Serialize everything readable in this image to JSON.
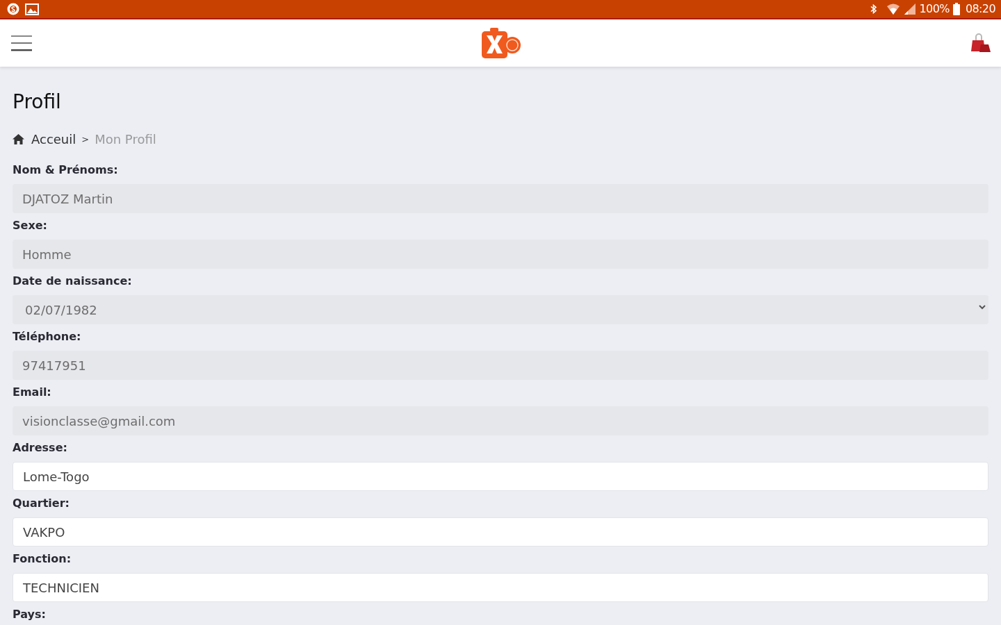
{
  "status_bar": {
    "battery": "100%",
    "time": "08:20"
  },
  "page": {
    "title": "Profil",
    "breadcrumb": [
      {
        "label": "Acceuil",
        "current": false
      },
      {
        "label": "Mon Profil",
        "current": true
      }
    ],
    "separator": ">"
  },
  "fields": [
    {
      "label": "Nom & Prénoms:",
      "value": "DJATOZ Martin",
      "kind": "text",
      "disabled": true
    },
    {
      "label": "Sexe:",
      "value": "Homme",
      "kind": "text",
      "disabled": true
    },
    {
      "label": "Date de naissance:",
      "value": "02/07/1982",
      "kind": "date",
      "disabled": true
    },
    {
      "label": "Téléphone:",
      "value": "97417951",
      "kind": "text",
      "disabled": true
    },
    {
      "label": "Email:",
      "value": "visionclasse@gmail.com",
      "kind": "text",
      "disabled": true
    },
    {
      "label": "Adresse:",
      "value": "Lome-Togo",
      "kind": "text",
      "disabled": false
    },
    {
      "label": "Quartier:",
      "value": "VAKPO",
      "kind": "text",
      "disabled": false
    },
    {
      "label": "Fonction:",
      "value": "TECHNICIEN",
      "kind": "text",
      "disabled": false
    },
    {
      "label": "Pays:"
    }
  ]
}
